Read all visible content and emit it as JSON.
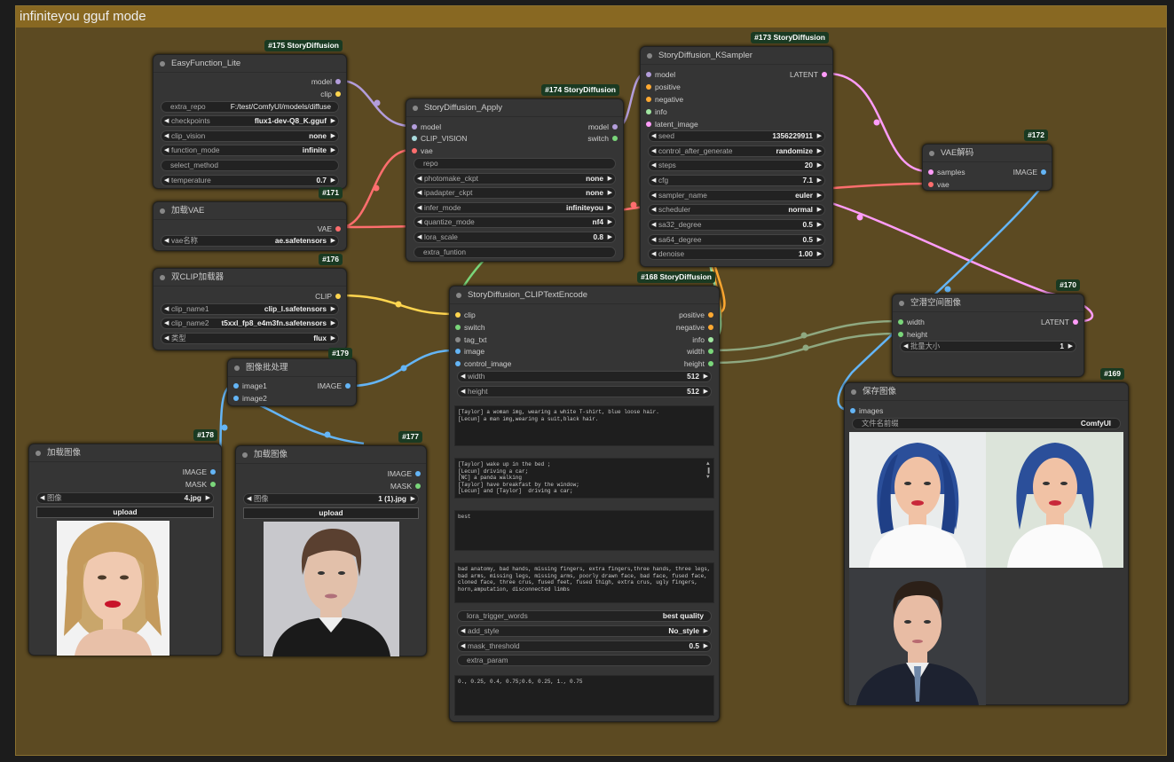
{
  "group_title": "infiniteyou gguf mode",
  "colors": {
    "model": "#b39ddb",
    "clip": "#ffd54f",
    "vae": "#ff6e6e",
    "latent": "#ff9cf9",
    "image": "#64b5f6",
    "conditioning": "#ffa931",
    "int": "#7ad67a",
    "string": "#a1e6a1",
    "clip_vision": "#a8dadc"
  },
  "nodes": {
    "easy": {
      "id": "#175 StoryDiffusion",
      "title": "EasyFunction_Lite",
      "outputs": [
        "model",
        "clip"
      ],
      "widgets": [
        {
          "label": "extra_repo",
          "value": "F:/test/ComfyUI/models/diffuse"
        },
        {
          "label": "checkpoints",
          "value": "flux1-dev-Q8_K.gguf"
        },
        {
          "label": "clip_vision",
          "value": "none"
        },
        {
          "label": "function_mode",
          "value": "infinite"
        },
        {
          "label": "select_method",
          "value": ""
        },
        {
          "label": "temperature",
          "value": "0.7"
        }
      ]
    },
    "vae": {
      "id": "#171",
      "title": "加载VAE",
      "outputs": [
        "VAE"
      ],
      "widgets": [
        {
          "label": "vae名称",
          "value": "ae.safetensors"
        }
      ]
    },
    "dclip": {
      "id": "#176",
      "title": "双CLIP加载器",
      "outputs": [
        "CLIP"
      ],
      "widgets": [
        {
          "label": "clip_name1",
          "value": "clip_l.safetensors"
        },
        {
          "label": "clip_name2",
          "value": "t5xxl_fp8_e4m3fn.safetensors"
        },
        {
          "label": "类型",
          "value": "flux"
        }
      ]
    },
    "batch": {
      "id": "#179",
      "title": "图像批处理",
      "inputs": [
        "image1",
        "image2"
      ],
      "outputs": [
        "IMAGE"
      ]
    },
    "load1": {
      "id": "#178",
      "title": "加载图像",
      "outputs": [
        "IMAGE",
        "MASK"
      ],
      "image_label": "图像",
      "image_value": "4.jpg",
      "upload": "upload"
    },
    "load2": {
      "id": "#177",
      "title": "加载图像",
      "outputs": [
        "IMAGE",
        "MASK"
      ],
      "image_label": "图像",
      "image_value": "1 (1).jpg",
      "upload": "upload"
    },
    "apply": {
      "id": "#174 StoryDiffusion",
      "title": "StoryDiffusion_Apply",
      "inputs": [
        "model",
        "CLIP_VISION",
        "vae"
      ],
      "outputs": [
        "model",
        "switch"
      ],
      "widgets": [
        {
          "label": "repo",
          "value": ""
        },
        {
          "label": "photomake_ckpt",
          "value": "none"
        },
        {
          "label": "ipadapter_ckpt",
          "value": "none"
        },
        {
          "label": "infer_mode",
          "value": "infiniteyou"
        },
        {
          "label": "quantize_mode",
          "value": "nf4"
        },
        {
          "label": "lora_scale",
          "value": "0.8"
        },
        {
          "label": "extra_funtion",
          "value": ""
        }
      ]
    },
    "ksampler": {
      "id": "#173 StoryDiffusion",
      "title": "StoryDiffusion_KSampler",
      "inputs": [
        "model",
        "positive",
        "negative",
        "info",
        "latent_image"
      ],
      "outputs": [
        "LATENT"
      ],
      "widgets": [
        {
          "label": "seed",
          "value": "1356229911"
        },
        {
          "label": "control_after_generate",
          "value": "randomize"
        },
        {
          "label": "steps",
          "value": "20"
        },
        {
          "label": "cfg",
          "value": "7.1"
        },
        {
          "label": "sampler_name",
          "value": "euler"
        },
        {
          "label": "scheduler",
          "value": "normal"
        },
        {
          "label": "sa32_degree",
          "value": "0.5"
        },
        {
          "label": "sa64_degree",
          "value": "0.5"
        },
        {
          "label": "denoise",
          "value": "1.00"
        }
      ]
    },
    "vaedec": {
      "id": "#172",
      "title": "VAE解码",
      "inputs": [
        "samples",
        "vae"
      ],
      "outputs": [
        "IMAGE"
      ]
    },
    "encode": {
      "id": "#168 StoryDiffusion",
      "title": "StoryDiffusion_CLIPTextEncode",
      "inputs": [
        "clip",
        "switch",
        "tag_txt",
        "image",
        "control_image"
      ],
      "outputs": [
        "positive",
        "negative",
        "info",
        "width",
        "height"
      ],
      "widgets": [
        {
          "label": "width",
          "value": "512"
        },
        {
          "label": "height",
          "value": "512"
        }
      ],
      "text1": "[Taylor] a woman img, wearing a white T-shirt, blue loose hair.\n[Lecun] a man img,wearing a suit,black hair.",
      "text2": "[Taylor] wake up in the bed ;\n[Lecun] driving a car;\n[NC] a panda walking\n[Taylor] have breakfast by the window;\n[Lecun] and [Taylor]  driving a car;",
      "text3": "best",
      "text4": "bad anatomy, bad hands, missing fingers, extra fingers,three hands, three legs, bad arms, missing legs, missing arms, poorly drawn face, bad face, fused face, cloned face, three crus, fused feet, fused thigh, extra crus, ugly fingers, horn,amputation, disconnected limbs",
      "widgets2": [
        {
          "label": "lora_trigger_words",
          "value": "best quality"
        },
        {
          "label": "add_style",
          "value": "No_style"
        },
        {
          "label": "mask_threshold",
          "value": "0.5"
        },
        {
          "label": "extra_param",
          "value": ""
        }
      ],
      "text5": "0., 0.25, 0.4, 0.75;0.6, 0.25, 1., 0.75"
    },
    "latent": {
      "id": "#170",
      "title": "空潜空间图像",
      "inputs": [
        "width",
        "height"
      ],
      "outputs": [
        "LATENT"
      ],
      "widgets": [
        {
          "label": "批量大小",
          "value": "1"
        }
      ]
    },
    "save": {
      "id": "#169",
      "title": "保存图像",
      "inputs": [
        "images"
      ],
      "widgets": [
        {
          "label": "文件名前缀",
          "value": "ComfyUI"
        }
      ]
    }
  }
}
